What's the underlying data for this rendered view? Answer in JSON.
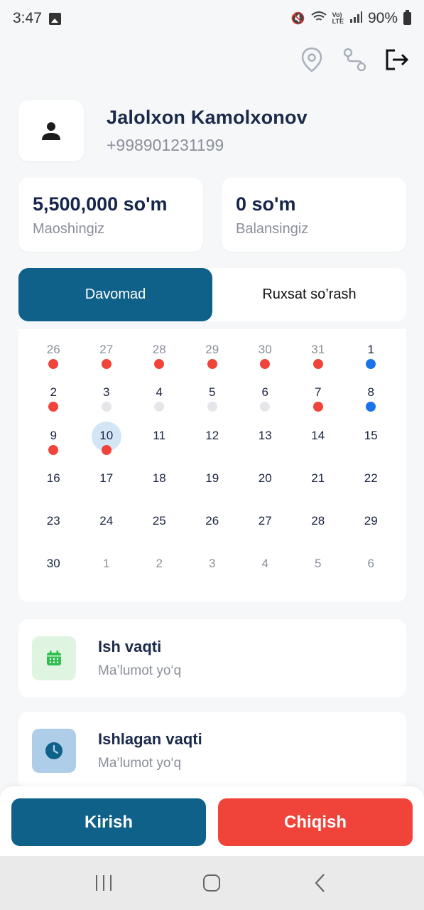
{
  "status_bar": {
    "time": "3:47",
    "battery": "90%"
  },
  "profile": {
    "name": "Jalolxon Kamolxonov",
    "phone": "+998901231199"
  },
  "stats": [
    {
      "value": "5,500,000 so'm",
      "label": "Maoshingiz"
    },
    {
      "value": "0 so'm",
      "label": "Balansingiz"
    }
  ],
  "tabs": [
    {
      "label": "Davomad",
      "active": true
    },
    {
      "label": "Ruxsat so’rash",
      "active": false
    }
  ],
  "calendar": {
    "days": [
      {
        "day": "26",
        "muted": true,
        "dot": "red"
      },
      {
        "day": "27",
        "muted": true,
        "dot": "red"
      },
      {
        "day": "28",
        "muted": true,
        "dot": "red"
      },
      {
        "day": "29",
        "muted": true,
        "dot": "red"
      },
      {
        "day": "30",
        "muted": true,
        "dot": "red"
      },
      {
        "day": "31",
        "muted": true,
        "dot": "red"
      },
      {
        "day": "1",
        "muted": false,
        "dot": "blue"
      },
      {
        "day": "2",
        "muted": false,
        "dot": "red"
      },
      {
        "day": "3",
        "muted": false,
        "dot": "grey"
      },
      {
        "day": "4",
        "muted": false,
        "dot": "grey"
      },
      {
        "day": "5",
        "muted": false,
        "dot": "grey"
      },
      {
        "day": "6",
        "muted": false,
        "dot": "grey"
      },
      {
        "day": "7",
        "muted": false,
        "dot": "red"
      },
      {
        "day": "8",
        "muted": false,
        "dot": "blue"
      },
      {
        "day": "9",
        "muted": false,
        "dot": "red"
      },
      {
        "day": "10",
        "muted": false,
        "dot": "red",
        "today": true
      },
      {
        "day": "11",
        "muted": false,
        "dot": ""
      },
      {
        "day": "12",
        "muted": false,
        "dot": ""
      },
      {
        "day": "13",
        "muted": false,
        "dot": ""
      },
      {
        "day": "14",
        "muted": false,
        "dot": ""
      },
      {
        "day": "15",
        "muted": false,
        "dot": ""
      },
      {
        "day": "16",
        "muted": false,
        "dot": ""
      },
      {
        "day": "17",
        "muted": false,
        "dot": ""
      },
      {
        "day": "18",
        "muted": false,
        "dot": ""
      },
      {
        "day": "19",
        "muted": false,
        "dot": ""
      },
      {
        "day": "20",
        "muted": false,
        "dot": ""
      },
      {
        "day": "21",
        "muted": false,
        "dot": ""
      },
      {
        "day": "22",
        "muted": false,
        "dot": ""
      },
      {
        "day": "23",
        "muted": false,
        "dot": ""
      },
      {
        "day": "24",
        "muted": false,
        "dot": ""
      },
      {
        "day": "25",
        "muted": false,
        "dot": ""
      },
      {
        "day": "26",
        "muted": false,
        "dot": ""
      },
      {
        "day": "27",
        "muted": false,
        "dot": ""
      },
      {
        "day": "28",
        "muted": false,
        "dot": ""
      },
      {
        "day": "29",
        "muted": false,
        "dot": ""
      },
      {
        "day": "30",
        "muted": false,
        "dot": ""
      },
      {
        "day": "1",
        "muted": true,
        "dot": ""
      },
      {
        "day": "2",
        "muted": true,
        "dot": ""
      },
      {
        "day": "3",
        "muted": true,
        "dot": ""
      },
      {
        "day": "4",
        "muted": true,
        "dot": ""
      },
      {
        "day": "5",
        "muted": true,
        "dot": ""
      },
      {
        "day": "6",
        "muted": true,
        "dot": ""
      }
    ]
  },
  "info": [
    {
      "title": "Ish vaqti",
      "sub": "Ma’lumot yo‘q",
      "icon": "calendar-icon"
    },
    {
      "title": "Ishlagan vaqti",
      "sub": "Ma’lumot yo‘q",
      "icon": "clock-icon"
    }
  ],
  "actions": {
    "in_label": "Kirish",
    "out_label": "Chiqish"
  },
  "colors": {
    "primary": "#0f6189",
    "danger": "#f0443a",
    "accent_blue": "#1a73e8",
    "background": "#f6f7f9"
  },
  "icons": [
    "location-pin-icon",
    "route-icon",
    "logout-icon",
    "user-icon",
    "recent-apps-icon",
    "home-icon",
    "back-icon"
  ]
}
